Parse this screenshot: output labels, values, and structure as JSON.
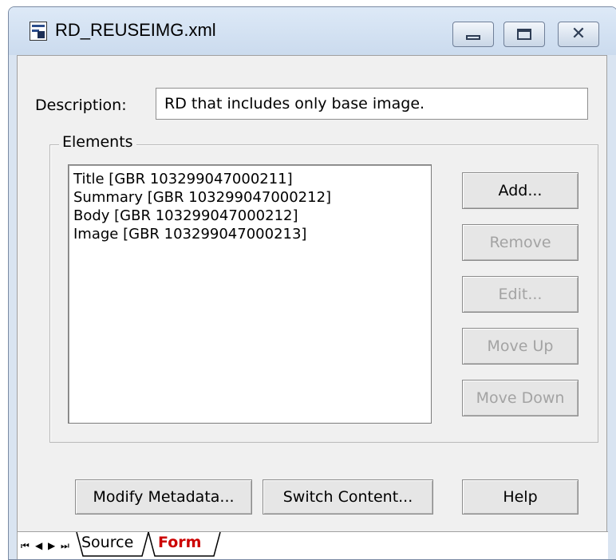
{
  "window": {
    "title": "RD_REUSEIMG.xml"
  },
  "description": {
    "label": "Description:",
    "value": "RD that includes only base image."
  },
  "elements": {
    "group_label": "Elements",
    "items": [
      "Title [GBR 103299047000211]",
      "Summary [GBR 103299047000212]",
      "Body [GBR 103299047000212]",
      "Image [GBR 103299047000213]"
    ]
  },
  "buttons": {
    "add": "Add...",
    "remove": "Remove",
    "edit": "Edit...",
    "move_up": "Move Up",
    "move_down": "Move Down",
    "modify_metadata": "Modify Metadata...",
    "switch_content": "Switch Content...",
    "help": "Help"
  },
  "tabs": {
    "source": "Source",
    "form": "Form",
    "active": "Form"
  },
  "colors": {
    "active_tab_text": "#cc0000",
    "disabled_text": "#a3a3a3",
    "titlebar": "#cbdbee"
  }
}
